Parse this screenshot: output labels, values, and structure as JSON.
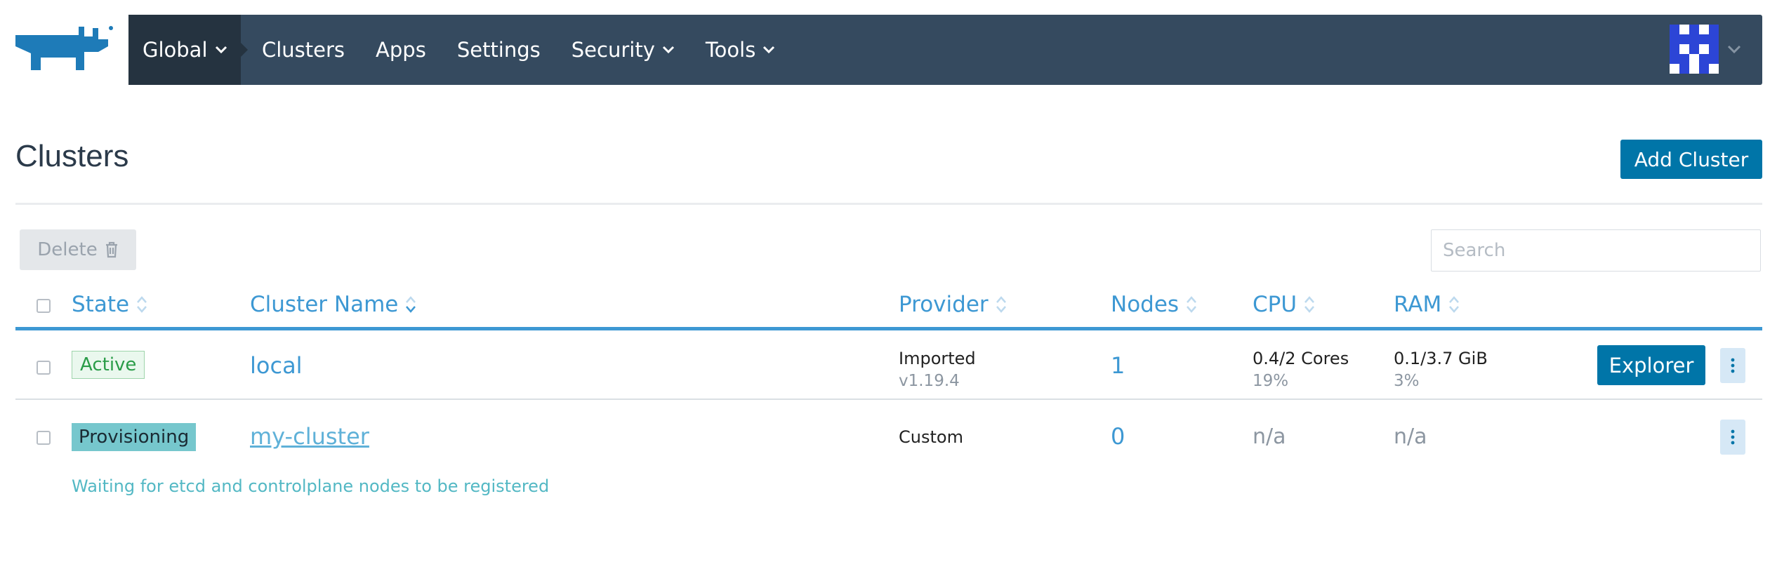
{
  "nav": {
    "items": [
      {
        "label": "Global",
        "dropdown": true
      },
      {
        "label": "Clusters",
        "dropdown": false
      },
      {
        "label": "Apps",
        "dropdown": false
      },
      {
        "label": "Settings",
        "dropdown": false
      },
      {
        "label": "Security",
        "dropdown": true
      },
      {
        "label": "Tools",
        "dropdown": true
      }
    ]
  },
  "page": {
    "title": "Clusters",
    "add_button": "Add Cluster"
  },
  "toolbar": {
    "delete_label": "Delete",
    "search_placeholder": "Search"
  },
  "table": {
    "columns": [
      "State",
      "Cluster Name",
      "Provider",
      "Nodes",
      "CPU",
      "RAM"
    ],
    "rows": [
      {
        "state": "Active",
        "name": "local",
        "provider": "Imported",
        "provider_version": "v1.19.4",
        "nodes": "1",
        "cpu": "0.4/2 Cores",
        "cpu_pct": "19%",
        "ram": "0.1/3.7 GiB",
        "ram_pct": "3%",
        "action": "Explorer"
      },
      {
        "state": "Provisioning",
        "name": "my-cluster",
        "provider": "Custom",
        "nodes": "0",
        "cpu": "n/a",
        "ram": "n/a",
        "message": "Waiting for etcd and controlplane nodes to be registered"
      }
    ]
  },
  "colors": {
    "navbar": "#354a5f",
    "nav_active": "#253340",
    "primary": "#0075a8",
    "link": "#3d98d3",
    "active_badge": "#2a9c48",
    "provisioning_badge": "#76c7cd"
  }
}
